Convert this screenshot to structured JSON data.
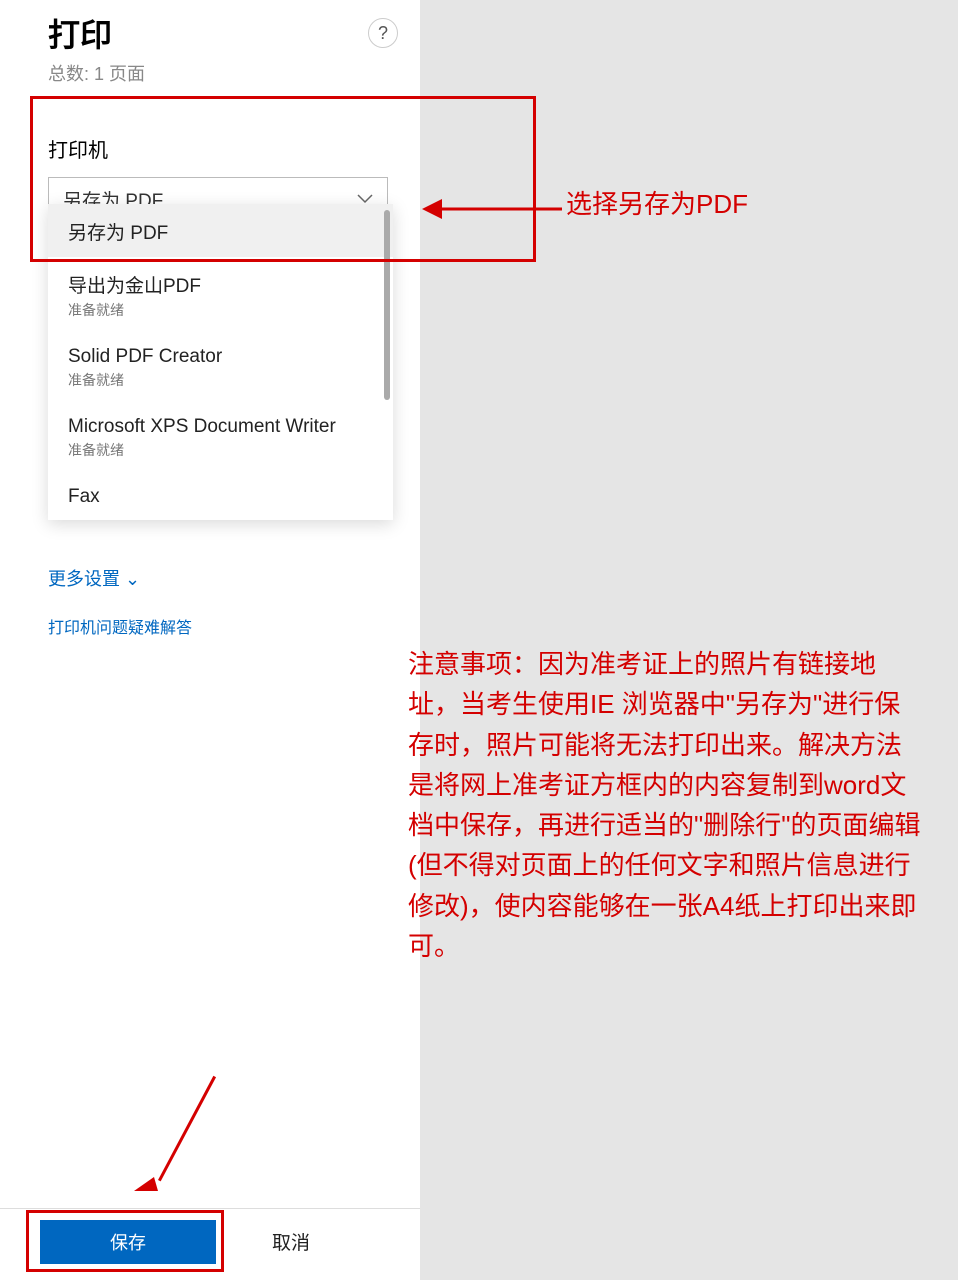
{
  "header": {
    "title": "打印",
    "subtitle": "总数: 1 页面",
    "help": "?"
  },
  "printer": {
    "section_label": "打印机",
    "selected": "另存为 PDF",
    "options": [
      {
        "name": "另存为 PDF",
        "status": ""
      },
      {
        "name": "导出为金山PDF",
        "status": "准备就绪"
      },
      {
        "name": "Solid PDF Creator",
        "status": "准备就绪"
      },
      {
        "name": "Microsoft XPS Document Writer",
        "status": "准备就绪"
      },
      {
        "name": "Fax",
        "status": ""
      }
    ],
    "ghost_label": "另存为 PDF"
  },
  "links": {
    "more_settings": "更多设置",
    "troubleshoot": "打印机问题疑难解答"
  },
  "footer": {
    "save": "保存",
    "cancel": "取消"
  },
  "annotation": {
    "select_pdf": "选择另存为PDF",
    "notice": "注意事项：因为准考证上的照片有链接地址，当考生使用IE 浏览器中\"另存为\"进行保存时，照片可能将无法打印出来。解决方法是将网上准考证方框内的内容复制到word文档中保存，再进行适当的\"删除行\"的页面编辑(但不得对页面上的任何文字和照片信息进行修改)，使内容能够在一张A4纸上打印出来即可。"
  }
}
